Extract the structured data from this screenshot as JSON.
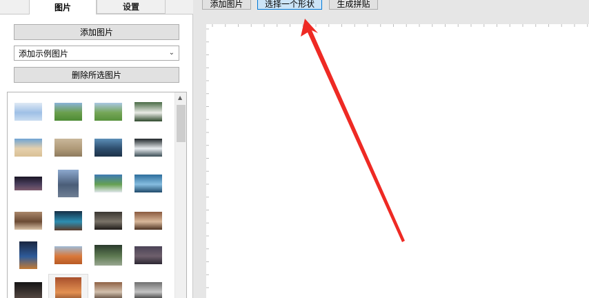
{
  "tabs": {
    "images_label": "图片",
    "settings_label": "设置"
  },
  "left": {
    "add_image_label": "添加图片",
    "sample_select_value": "添加示例图片",
    "delete_selected_label": "删除所选图片"
  },
  "toolbar": {
    "add_image_label": "添加图片",
    "choose_shape_label": "选择一个形状",
    "generate_collage_label": "生成拼贴"
  },
  "gallery": {
    "thumbnails": [
      {
        "name": "thumb-spreadsheet",
        "colors": [
          "#dfe9f5",
          "#9fc0e6",
          "#c9dcf0"
        ]
      },
      {
        "name": "thumb-meadow-1",
        "colors": [
          "#8ab3d8",
          "#6a9f4c",
          "#4d8b35"
        ]
      },
      {
        "name": "thumb-meadow-2",
        "colors": [
          "#a9c7e3",
          "#75a657",
          "#57913c"
        ]
      },
      {
        "name": "thumb-dark-screen",
        "colors": [
          "#4a6b46",
          "#e9ebe6",
          "#2f4a2d"
        ]
      },
      {
        "name": "thumb-beach",
        "colors": [
          "#6fa4d4",
          "#e5d0ac",
          "#d9c095"
        ]
      },
      {
        "name": "thumb-hazy-pier",
        "colors": [
          "#c9b79a",
          "#b09b79",
          "#8d7a5e"
        ]
      },
      {
        "name": "thumb-coast-dusk",
        "colors": [
          "#5c8fb8",
          "#2e4e6e",
          "#1d3248"
        ]
      },
      {
        "name": "thumb-waterfall",
        "colors": [
          "#1f2529",
          "#e8ecef",
          "#3b4d55"
        ]
      },
      {
        "name": "thumb-night-sky",
        "colors": [
          "#1a1625",
          "#4a3f5c",
          "#7d5b6e"
        ]
      },
      {
        "name": "thumb-city-tower",
        "colors": [
          "#8da9cf",
          "#4a5d78",
          "#6f7f94"
        ]
      },
      {
        "name": "thumb-aerial-field",
        "colors": [
          "#3e7ab3",
          "#66a152",
          "#e1e7ec"
        ]
      },
      {
        "name": "thumb-lake-mountain",
        "colors": [
          "#2c6d9c",
          "#86bde0",
          "#204a6b"
        ]
      },
      {
        "name": "thumb-cafe-table",
        "colors": [
          "#a9876a",
          "#6b4b34",
          "#d9c2a8"
        ]
      },
      {
        "name": "thumb-sea-cave",
        "colors": [
          "#153047",
          "#2d8db1",
          "#5b3b2a"
        ]
      },
      {
        "name": "thumb-bus-interior",
        "colors": [
          "#3a3631",
          "#7a7368",
          "#1e1b18"
        ]
      },
      {
        "name": "thumb-desk-flatlay",
        "colors": [
          "#8a5a3f",
          "#d9b89a",
          "#4d3322"
        ]
      },
      {
        "name": "thumb-canyon-night",
        "colors": [
          "#1a2640",
          "#2e5b99",
          "#c27a34"
        ]
      },
      {
        "name": "thumb-desert-dunes",
        "colors": [
          "#9fbbd6",
          "#d9793b",
          "#b85a25"
        ]
      },
      {
        "name": "thumb-forest-car",
        "colors": [
          "#2a3b2c",
          "#5e7a52",
          "#9aa892"
        ]
      },
      {
        "name": "thumb-dusk-harbor",
        "colors": [
          "#4b4356",
          "#6e5f6c",
          "#2c2733"
        ]
      },
      {
        "name": "thumb-dark-portrait",
        "colors": [
          "#151515",
          "#3b3330",
          "#5a4b45"
        ]
      },
      {
        "name": "thumb-antelope-canyon",
        "colors": [
          "#a8502c",
          "#e39152",
          "#5c2a18"
        ]
      },
      {
        "name": "thumb-workbench",
        "colors": [
          "#8f6245",
          "#d2c0ad",
          "#4d3a2d"
        ]
      },
      {
        "name": "thumb-bw-forest",
        "colors": [
          "#6f6f6f",
          "#c4c4c4",
          "#2a2a2a"
        ]
      }
    ]
  },
  "colors": {
    "arrow": "#ee2a24",
    "selected_button": "#cce4f7",
    "selected_border": "#0078d7"
  }
}
